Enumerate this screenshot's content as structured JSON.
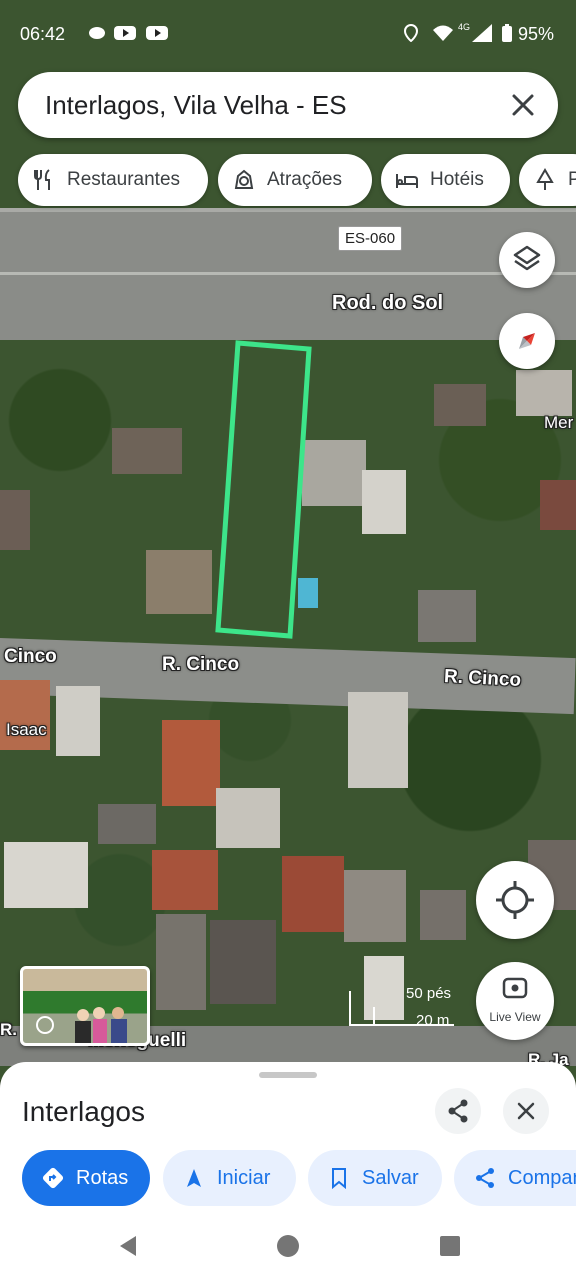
{
  "status_bar": {
    "time": "06:42",
    "battery": "95%",
    "network": "4G"
  },
  "search": {
    "query": "Interlagos, Vila Velha - ES"
  },
  "chips": [
    {
      "label": "Restaurantes",
      "icon": "fork-knife-icon"
    },
    {
      "label": "Atrações",
      "icon": "attraction-icon"
    },
    {
      "label": "Hotéis",
      "icon": "bed-icon"
    },
    {
      "label": "P",
      "icon": "park-icon"
    }
  ],
  "map": {
    "shield": "ES-060",
    "roads": [
      "Rod. do Sol",
      "Cinco",
      "R. Cinco",
      "R. Cinco"
    ],
    "place_labels": [
      "Mer",
      "Isaac",
      "R.",
      "Meneguelli",
      "R. Ja"
    ],
    "scale": {
      "imperial": "50 pés",
      "metric": "20 m"
    },
    "live_view": "Live View",
    "highlight_color": "#3de58a"
  },
  "sheet": {
    "title": "Interlagos",
    "actions": [
      {
        "label": "Rotas",
        "icon": "directions-icon",
        "style": "primary"
      },
      {
        "label": "Iniciar",
        "icon": "navigation-arrow-icon",
        "style": "secondary"
      },
      {
        "label": "Salvar",
        "icon": "bookmark-icon",
        "style": "secondary"
      },
      {
        "label": "Compar",
        "icon": "share-icon",
        "style": "secondary"
      }
    ]
  }
}
